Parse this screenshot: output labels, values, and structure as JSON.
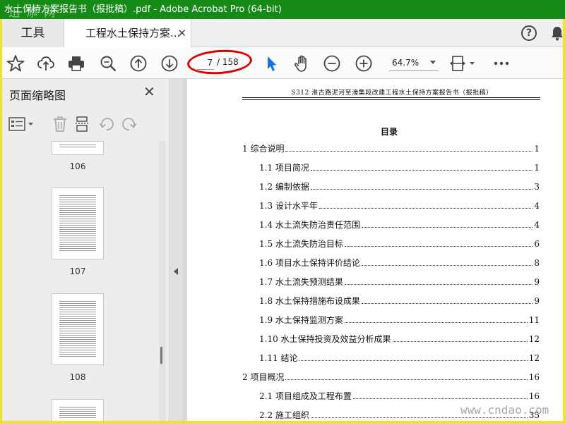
{
  "window": {
    "title": "水土保持方案报告书（报批稿）.pdf - Adobe Acrobat Pro (64-bit)",
    "watermark_top": "迅 添 网",
    "watermark_bottom": "www.cndao.com"
  },
  "tabs": {
    "tools_label": "工具",
    "doc_label": "工程水土保持方案...",
    "close_glyph": "✕",
    "help_glyph": "?"
  },
  "toolbar": {
    "current_page": "7",
    "total_pages": "/ 158",
    "zoom": "64.7%"
  },
  "left_panel": {
    "title": "页面缩略图",
    "close_glyph": "✕",
    "thumbnails": [
      {
        "label": "106"
      },
      {
        "label": "107"
      },
      {
        "label": "108"
      }
    ]
  },
  "document": {
    "header": "S312 淮古路泥河至濠集段改建工程水土保持方案报告书（报批稿）",
    "toc_title": "目录",
    "toc": [
      {
        "label": "1 综合说明",
        "page": "1",
        "level": 1
      },
      {
        "label": "1.1 项目简况",
        "page": "1",
        "level": 2
      },
      {
        "label": "1.2 编制依据",
        "page": "3",
        "level": 2
      },
      {
        "label": "1.3 设计水平年",
        "page": "4",
        "level": 2
      },
      {
        "label": "1.4 水土流失防治责任范围",
        "page": "4",
        "level": 2
      },
      {
        "label": "1.5 水土流失防治目标",
        "page": "6",
        "level": 2
      },
      {
        "label": "1.6 项目水土保持评价结论",
        "page": "8",
        "level": 2
      },
      {
        "label": "1.7 水土流失预测结果",
        "page": "9",
        "level": 2
      },
      {
        "label": "1.8 水土保持措施布设成果",
        "page": "9",
        "level": 2
      },
      {
        "label": "1.9 水土保持监测方案",
        "page": "11",
        "level": 2
      },
      {
        "label": "1.10 水土保持投资及效益分析成果",
        "page": "12",
        "level": 2
      },
      {
        "label": "1.11 结论",
        "page": "12",
        "level": 2
      },
      {
        "label": "2 项目概况",
        "page": "16",
        "level": 1
      },
      {
        "label": "2.1 项目组成及工程布置",
        "page": "16",
        "level": 2
      },
      {
        "label": "2.2 施工组织",
        "page": "35",
        "level": 2
      }
    ]
  },
  "colors": {
    "titlebar": "#168a16",
    "frame": "#f0e030",
    "highlight": "#e00000",
    "select_tool": "#1473e6"
  }
}
